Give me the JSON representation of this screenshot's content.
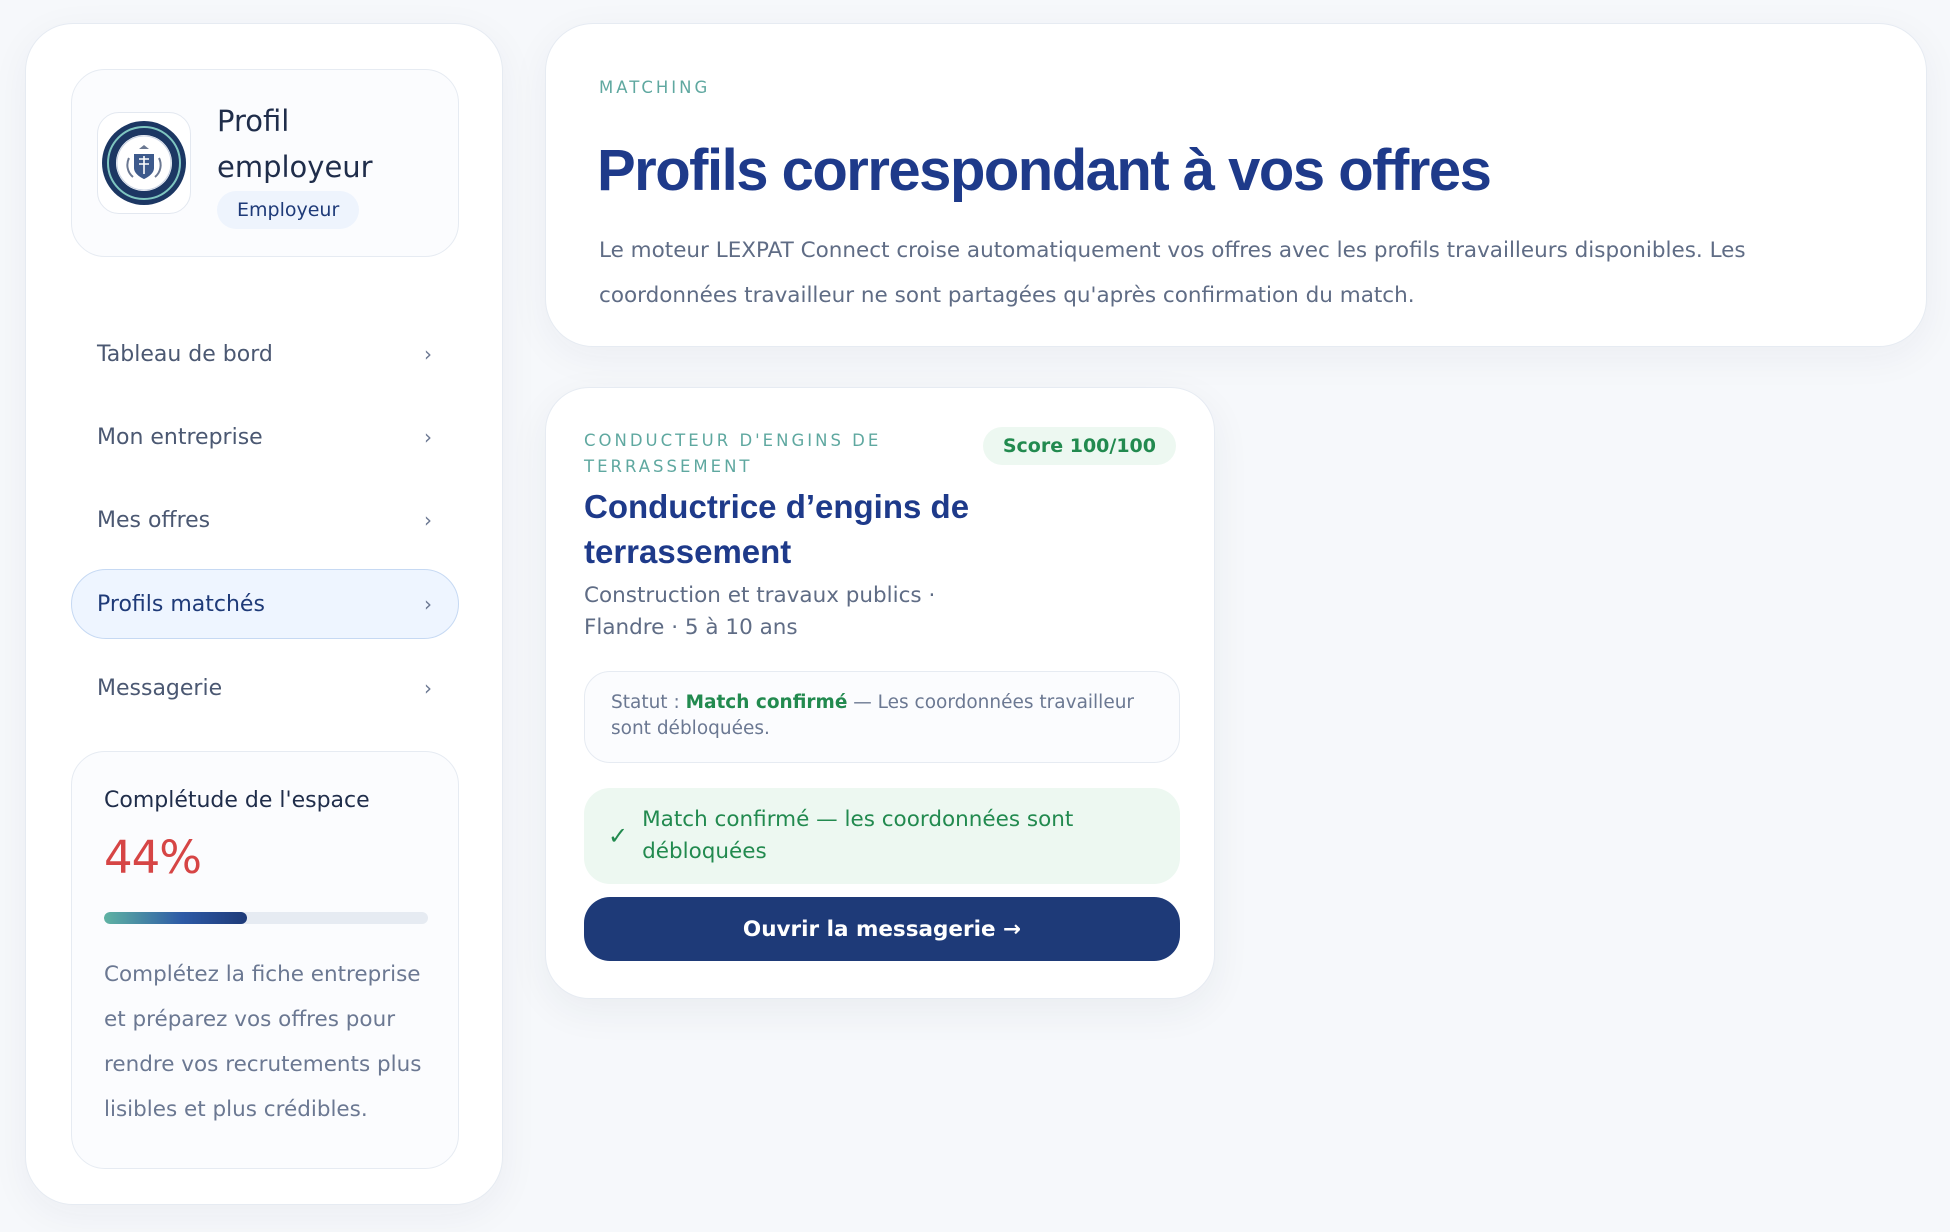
{
  "sidebar": {
    "profile": {
      "title": "Profil employeur",
      "role_badge": "Employeur"
    },
    "nav": [
      {
        "label": "Tableau de bord",
        "active": false
      },
      {
        "label": "Mon entreprise",
        "active": false
      },
      {
        "label": "Mes offres",
        "active": false
      },
      {
        "label": "Profils matchés",
        "active": true
      },
      {
        "label": "Messagerie",
        "active": false
      }
    ],
    "completion": {
      "title": "Complétude de l'espace",
      "value_text": "44%",
      "percent": 44,
      "description": "Complétez la fiche entreprise et préparez vos offres pour rendre vos recrutements plus lisibles et plus crédibles."
    }
  },
  "header": {
    "eyebrow": "MATCHING",
    "title": "Profils correspondant à vos offres",
    "description": "Le moteur LEXPAT Connect croise automatiquement vos offres avec les profils travailleurs disponibles. Les coordonnées travailleur ne sont partagées qu'après confirmation du match."
  },
  "matches": [
    {
      "category": "CONDUCTEUR D'ENGINS DE TERRASSEMENT",
      "score": "Score 100/100",
      "name": "Conductrice d’engins de terrassement",
      "meta": "Construction et travaux publics · Flandre · 5 à 10 ans",
      "status_label": "Statut : ",
      "status_value": "Match confirmé",
      "status_detail": " — Les coordonnées travailleur sont débloquées.",
      "confirm_text": "Match confirmé — les coordonnées sont débloquées",
      "button_label": "Ouvrir la messagerie →"
    }
  ],
  "colors": {
    "brand": "#1e3a78",
    "title": "#1e3a8a",
    "accent_teal": "#5fa8a0",
    "success": "#228a4f",
    "danger": "#d64545"
  },
  "icons": {
    "nav_chevron": "chevron-right-icon",
    "confirm": "check-icon",
    "logo": "company-crest-logo"
  }
}
